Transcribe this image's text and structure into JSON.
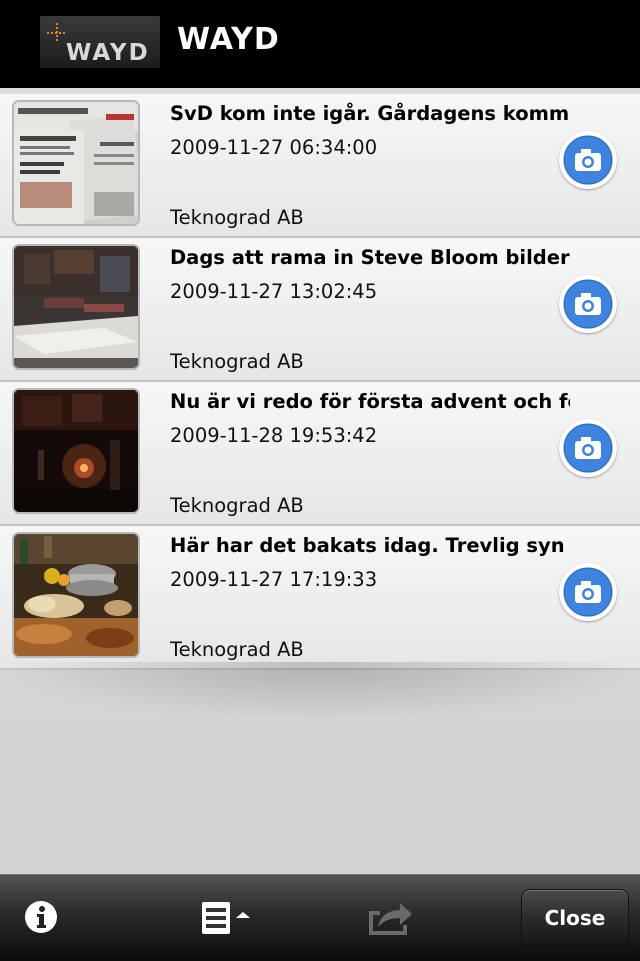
{
  "header": {
    "logo_text": "WAYD",
    "title": "WAYD"
  },
  "posts": [
    {
      "title": "SvD kom inte igår. Gårdagens komm",
      "date": "2009-11-27 06:34:00",
      "author": "Teknograd AB",
      "thumb_icon": "newspaper-photo"
    },
    {
      "title": "Dags att rama in Steve Bloom bildern",
      "date": "2009-11-27 13:02:45",
      "author": "Teknograd AB",
      "thumb_icon": "workshop-photo"
    },
    {
      "title": "Nu är vi redo för första advent och fö",
      "date": "2009-11-28 19:53:42",
      "author": "Teknograd AB",
      "thumb_icon": "advent-candles-photo"
    },
    {
      "title": "Här har det bakats idag. Trevlig syn o",
      "date": "2009-11-27 17:19:33",
      "author": "Teknograd AB",
      "thumb_icon": "baking-photo"
    }
  ],
  "toolbar": {
    "info_icon": "info-icon",
    "list_icon": "list-menu-icon",
    "share_icon": "share-icon",
    "close_label": "Close"
  },
  "colors": {
    "header_bg": "#000000",
    "camera_blue": "#3e83de",
    "toolbar_dark": "#111111"
  }
}
